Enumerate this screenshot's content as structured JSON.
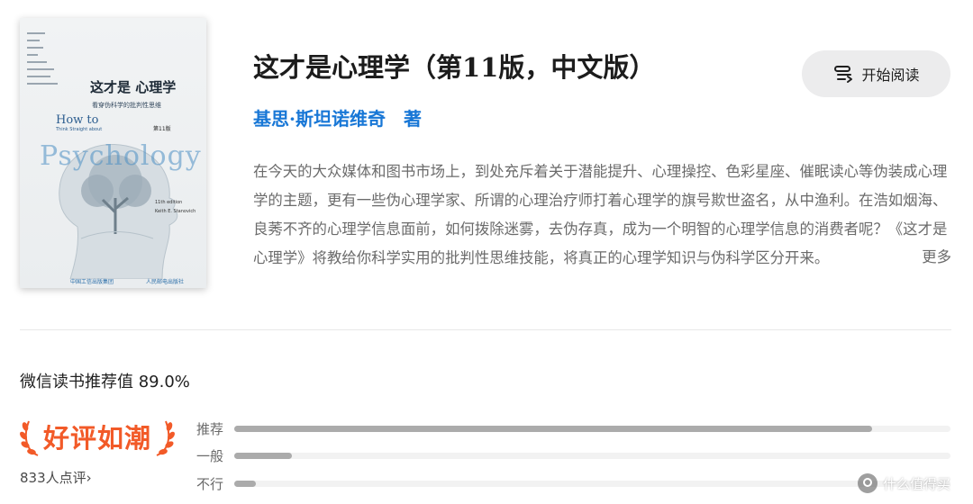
{
  "book": {
    "title": "这才是心理学（第11版，中文版）",
    "author": "基思·斯坦诺维奇　著",
    "read_button_label": "开始阅读",
    "description": "在今天的大众媒体和图书市场上，到处充斥着关于潜能提升、心理操控、色彩星座、催眠读心等伪装成心理学的主题，更有一些伪心理学家、所谓的心理治疗师打着心理学的旗号欺世盗名，从中渔利。在浩如烟海、良莠不齐的心理学信息面前，如何拨除迷雾，去伪存真，成为一个明智的心理学信息的消费者呢？《这才是心理学》将教给你科学实用的批判性思维技能，将真正的心理学知识与伪科学区分开来。",
    "more_label": "更多"
  },
  "cover": {
    "title_cn": "这才是 心理学",
    "subtitle_cn": "看穿伪科学的批判性思维",
    "title_en_line1": "How to",
    "title_en_line2": "Think Straight about",
    "title_en_big": "Psychology",
    "edition_cn": "第11版",
    "edition_en": "11th edition",
    "author_en": "Keith E. Stanovich",
    "publisher_1": "中国工信出版集团",
    "publisher_2": "人民邮电出版社"
  },
  "rating": {
    "recommend_label": "微信读书推荐值 89.0%",
    "badge_text": "好评如潮",
    "reviews_link": "833人点评",
    "reviews_chevron": "›",
    "bars": [
      {
        "label": "推荐",
        "fraction": 0.89
      },
      {
        "label": "一般",
        "fraction": 0.08
      },
      {
        "label": "不行",
        "fraction": 0.03
      }
    ]
  },
  "watermark": {
    "text": "什么值得买"
  },
  "colors": {
    "accent_blue": "#1877d6",
    "badge_orange": "#f25a28",
    "bar_fill": "#ababab",
    "bar_track": "#f2f2f2"
  },
  "icons": [
    "book-read-icon",
    "chevron-right-icon",
    "laurel-left-icon",
    "laurel-right-icon",
    "watermark-logo-icon"
  ]
}
